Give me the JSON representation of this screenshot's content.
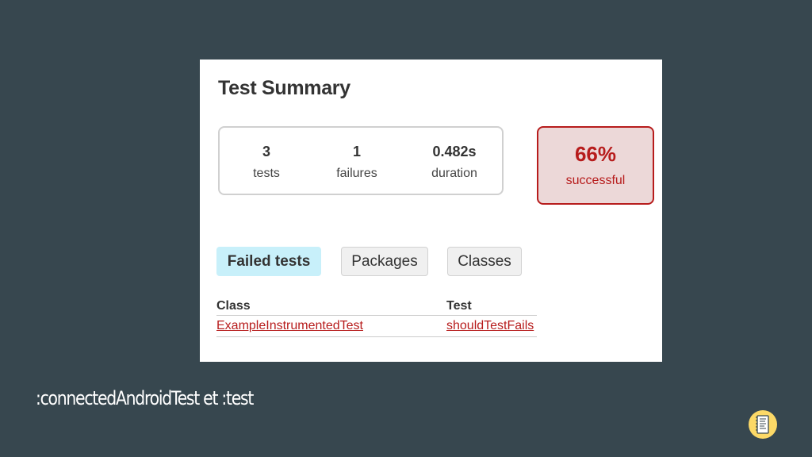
{
  "report": {
    "title": "Test Summary",
    "stats": [
      {
        "value": "3",
        "label": "tests"
      },
      {
        "value": "1",
        "label": "failures"
      },
      {
        "value": "0.482s",
        "label": "duration"
      }
    ],
    "success": {
      "value": "66%",
      "label": "successful"
    },
    "tabs": [
      "Failed tests",
      "Packages",
      "Classes"
    ],
    "table": {
      "headers": [
        "Class",
        "Test"
      ],
      "rows": [
        {
          "class": "ExampleInstrumentedTest",
          "test": "shouldTestFails"
        }
      ]
    }
  },
  "slide": {
    "caption": ":connectedAndroidTest et :test",
    "logo_icon": "notebook-icon"
  },
  "colors": {
    "background": "#37474f",
    "failure_red": "#b71c1c",
    "failure_bg": "#ecd8d8",
    "active_tab": "#c8f0fa"
  }
}
